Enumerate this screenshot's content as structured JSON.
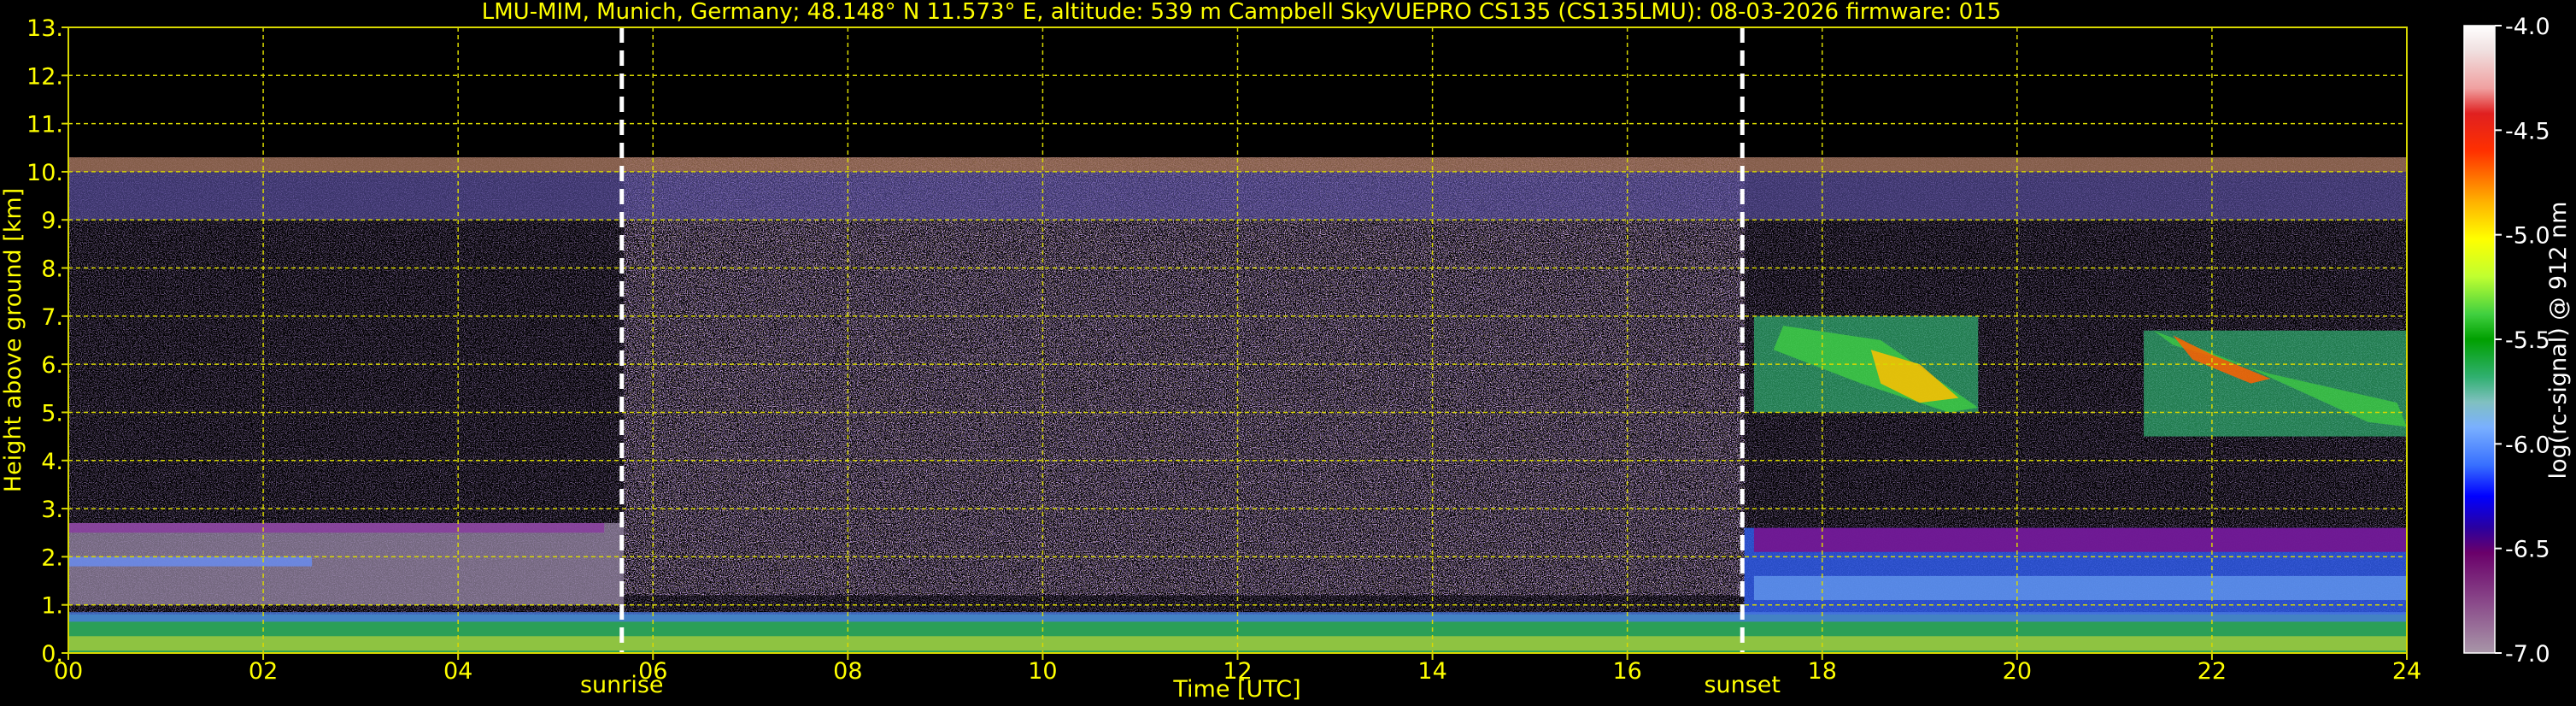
{
  "chart_data": {
    "type": "heatmap",
    "title": "LMU-MIM, Munich, Germany; 48.148° N 11.573° E, altitude: 539 m    Campbell SkyVUEPRO CS135 (CS135LMU): 08-03-2026    firmware: 015",
    "xlabel": "Time [UTC]",
    "ylabel": "Height above ground [km]",
    "xlim": [
      0,
      24
    ],
    "ylim": [
      0,
      13
    ],
    "x_ticks": [
      "00",
      "02",
      "04",
      "06",
      "08",
      "10",
      "12",
      "14",
      "16",
      "18",
      "20",
      "22",
      "24"
    ],
    "y_ticks": [
      "0.",
      "1.",
      "2.",
      "3.",
      "4.",
      "5.",
      "6.",
      "7.",
      "8.",
      "9.",
      "10.",
      "11.",
      "12.",
      "13."
    ],
    "grid": true,
    "markers": [
      {
        "label": "sunrise",
        "x": 5.68
      },
      {
        "label": "sunset",
        "x": 17.18
      }
    ],
    "colorbar": {
      "label": "log(rc-signal) @ 912 nm",
      "range": [
        -7.0,
        -4.0
      ],
      "ticks": [
        "-4.0",
        "-4.5",
        "-5.0",
        "-5.5",
        "-6.0",
        "-6.5",
        "-7.0"
      ]
    },
    "features": [
      {
        "feature": "cirrus layer",
        "t_start": 0,
        "t_end": 24,
        "h_bottom": 9.0,
        "h_top": 10.3
      },
      {
        "feature": "boundary layer aerosol",
        "t_start": 0,
        "t_end": 24,
        "h_bottom": 0,
        "h_top": 0.8
      },
      {
        "feature": "residual layer",
        "t_start": 0,
        "t_end": 5.7,
        "h_bottom": 1.0,
        "h_top": 2.7
      },
      {
        "feature": "evening aerosol layer",
        "t_start": 17.2,
        "t_end": 24,
        "h_bottom": 0.8,
        "h_top": 2.6
      },
      {
        "feature": "mid-level cloud",
        "t_start": 17.3,
        "t_end": 19.6,
        "h_bottom": 5.0,
        "h_top": 7.0
      },
      {
        "feature": "mid-level cloud",
        "t_start": 21.3,
        "t_end": 24,
        "h_bottom": 4.5,
        "h_top": 6.7
      }
    ]
  },
  "colors": {
    "text": "#ffff00",
    "grid": "#d8d800",
    "background": "#000000",
    "marker": "#ffffff"
  }
}
